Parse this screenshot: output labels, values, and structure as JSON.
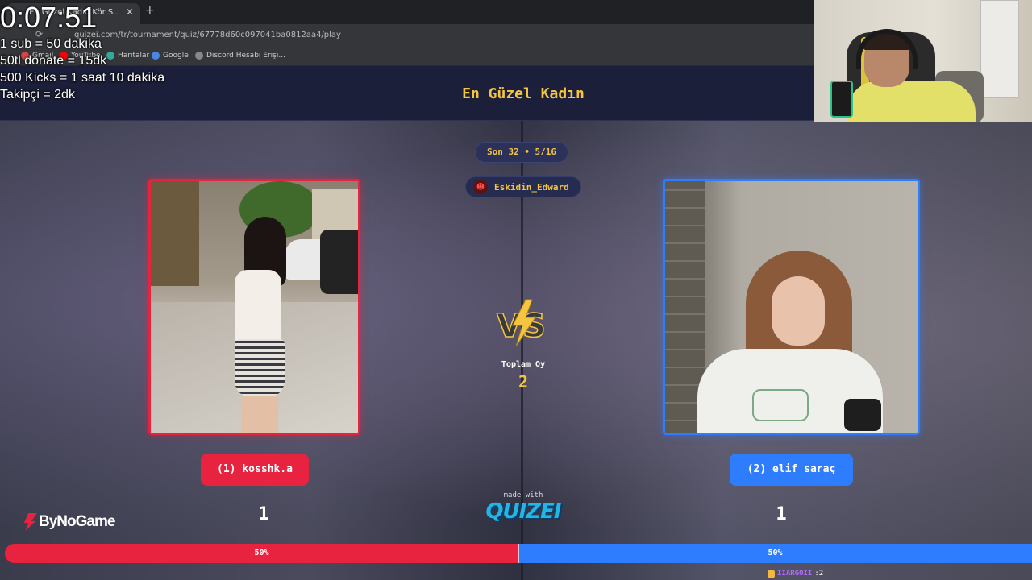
{
  "browser": {
    "tab_title": "En Güzel Kadın Kör S...",
    "url": "quizei.com/tr/tournament/quiz/67778d60c097041ba0812aa4/play",
    "bookmarks": [
      "Gmail",
      "YouTube",
      "Haritalar",
      "Google",
      "Discord Hesabı Erişi..."
    ]
  },
  "stream_overlay": {
    "timer": "0:07:51",
    "rules": [
      "1 sub = 50 dakika",
      "50tl donate =  15dk",
      "500 Kicks  = 1 saat 10 dakika",
      "Takipçi = 2dk"
    ]
  },
  "quiz": {
    "title": "En Güzel Kadın",
    "round": "Son 32 • 5/16",
    "player_name": "Eskidin_Edward",
    "vs_icon": "vs-lightning-icon",
    "total_votes_label": "Toplam Oy",
    "total_votes": "2"
  },
  "contestants": {
    "left": {
      "label": "(1) kosshk.a",
      "score": "1",
      "percent_label": "50%",
      "percent": 50,
      "color": "#e8233f"
    },
    "right": {
      "label": "(2) elif saraç",
      "score": "1",
      "percent_label": "50%",
      "percent": 50,
      "color": "#2f7dff"
    }
  },
  "branding": {
    "made_with": "made with",
    "quizei": "QUIZEI",
    "sponsor": "ByNoGame"
  },
  "chat": {
    "user": "IIARGOII",
    "message": ":2"
  },
  "colors": {
    "accent_yellow": "#f5c542",
    "left_red": "#e8233f",
    "right_blue": "#2f7dff",
    "header_bg": "#1c1f3a"
  }
}
